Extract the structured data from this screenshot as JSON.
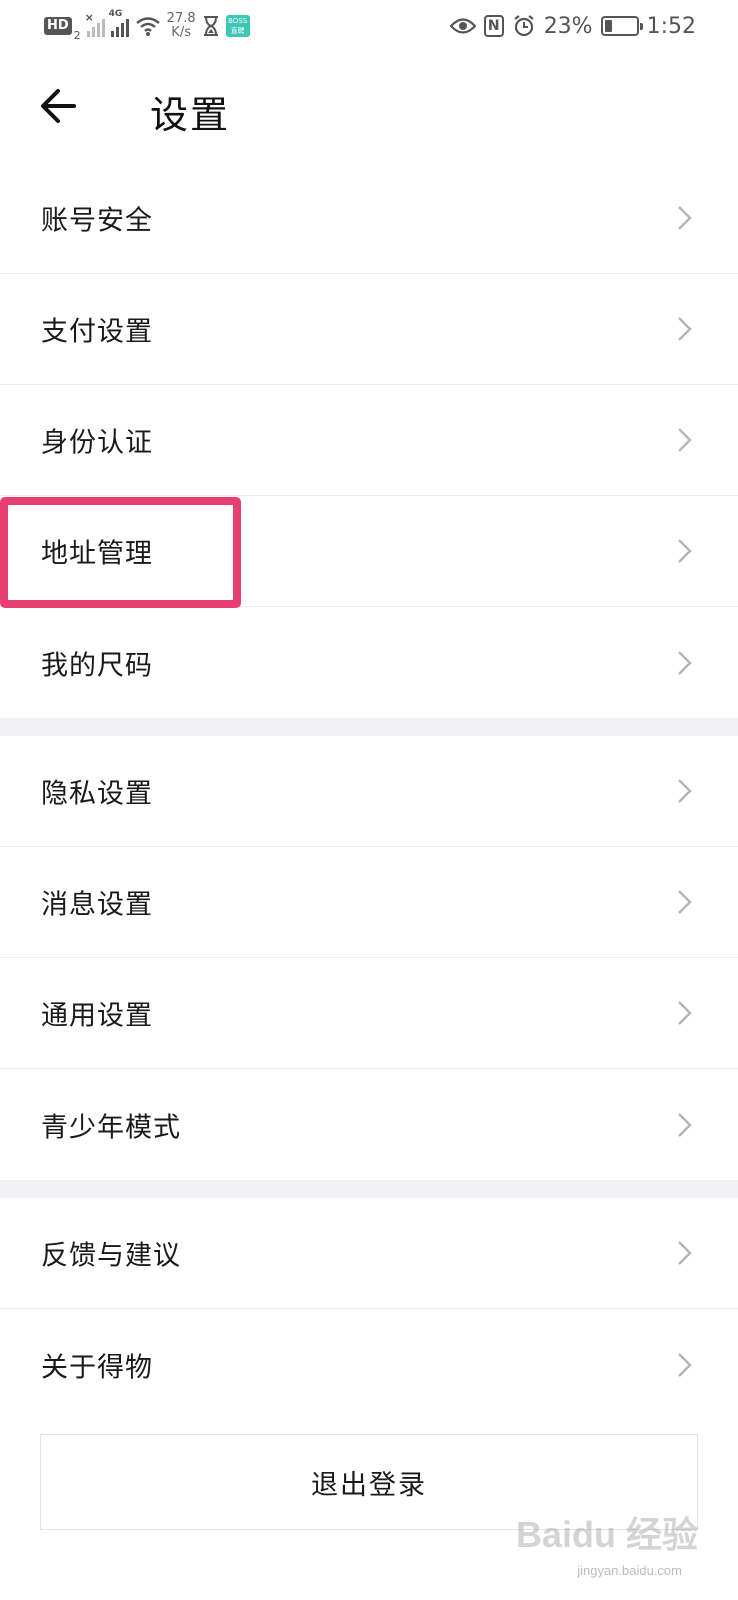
{
  "status_bar": {
    "hd_label": "HD",
    "hd_sub": "2",
    "network_label": "4G",
    "speed_value": "27.8",
    "speed_unit": "K/s",
    "app_badge_label": "BOSS 直聘",
    "battery_percent_text": "23%",
    "battery_level": 0.23,
    "time": "1:52"
  },
  "header": {
    "title": "设置"
  },
  "groups": [
    {
      "items": [
        {
          "label": "账号安全"
        },
        {
          "label": "支付设置"
        },
        {
          "label": "身份认证"
        },
        {
          "label": "地址管理"
        },
        {
          "label": "我的尺码"
        }
      ]
    },
    {
      "items": [
        {
          "label": "隐私设置"
        },
        {
          "label": "消息设置"
        },
        {
          "label": "通用设置"
        },
        {
          "label": "青少年模式"
        }
      ]
    },
    {
      "items": [
        {
          "label": "反馈与建议"
        },
        {
          "label": "关于得物"
        }
      ]
    }
  ],
  "logout_label": "退出登录",
  "watermark": {
    "text": "Baidu 经验",
    "sub": "jingyan.baidu.com"
  },
  "colors": {
    "highlight": "#e83f73",
    "gap": "#f2f2f4",
    "divider": "#ececec"
  }
}
